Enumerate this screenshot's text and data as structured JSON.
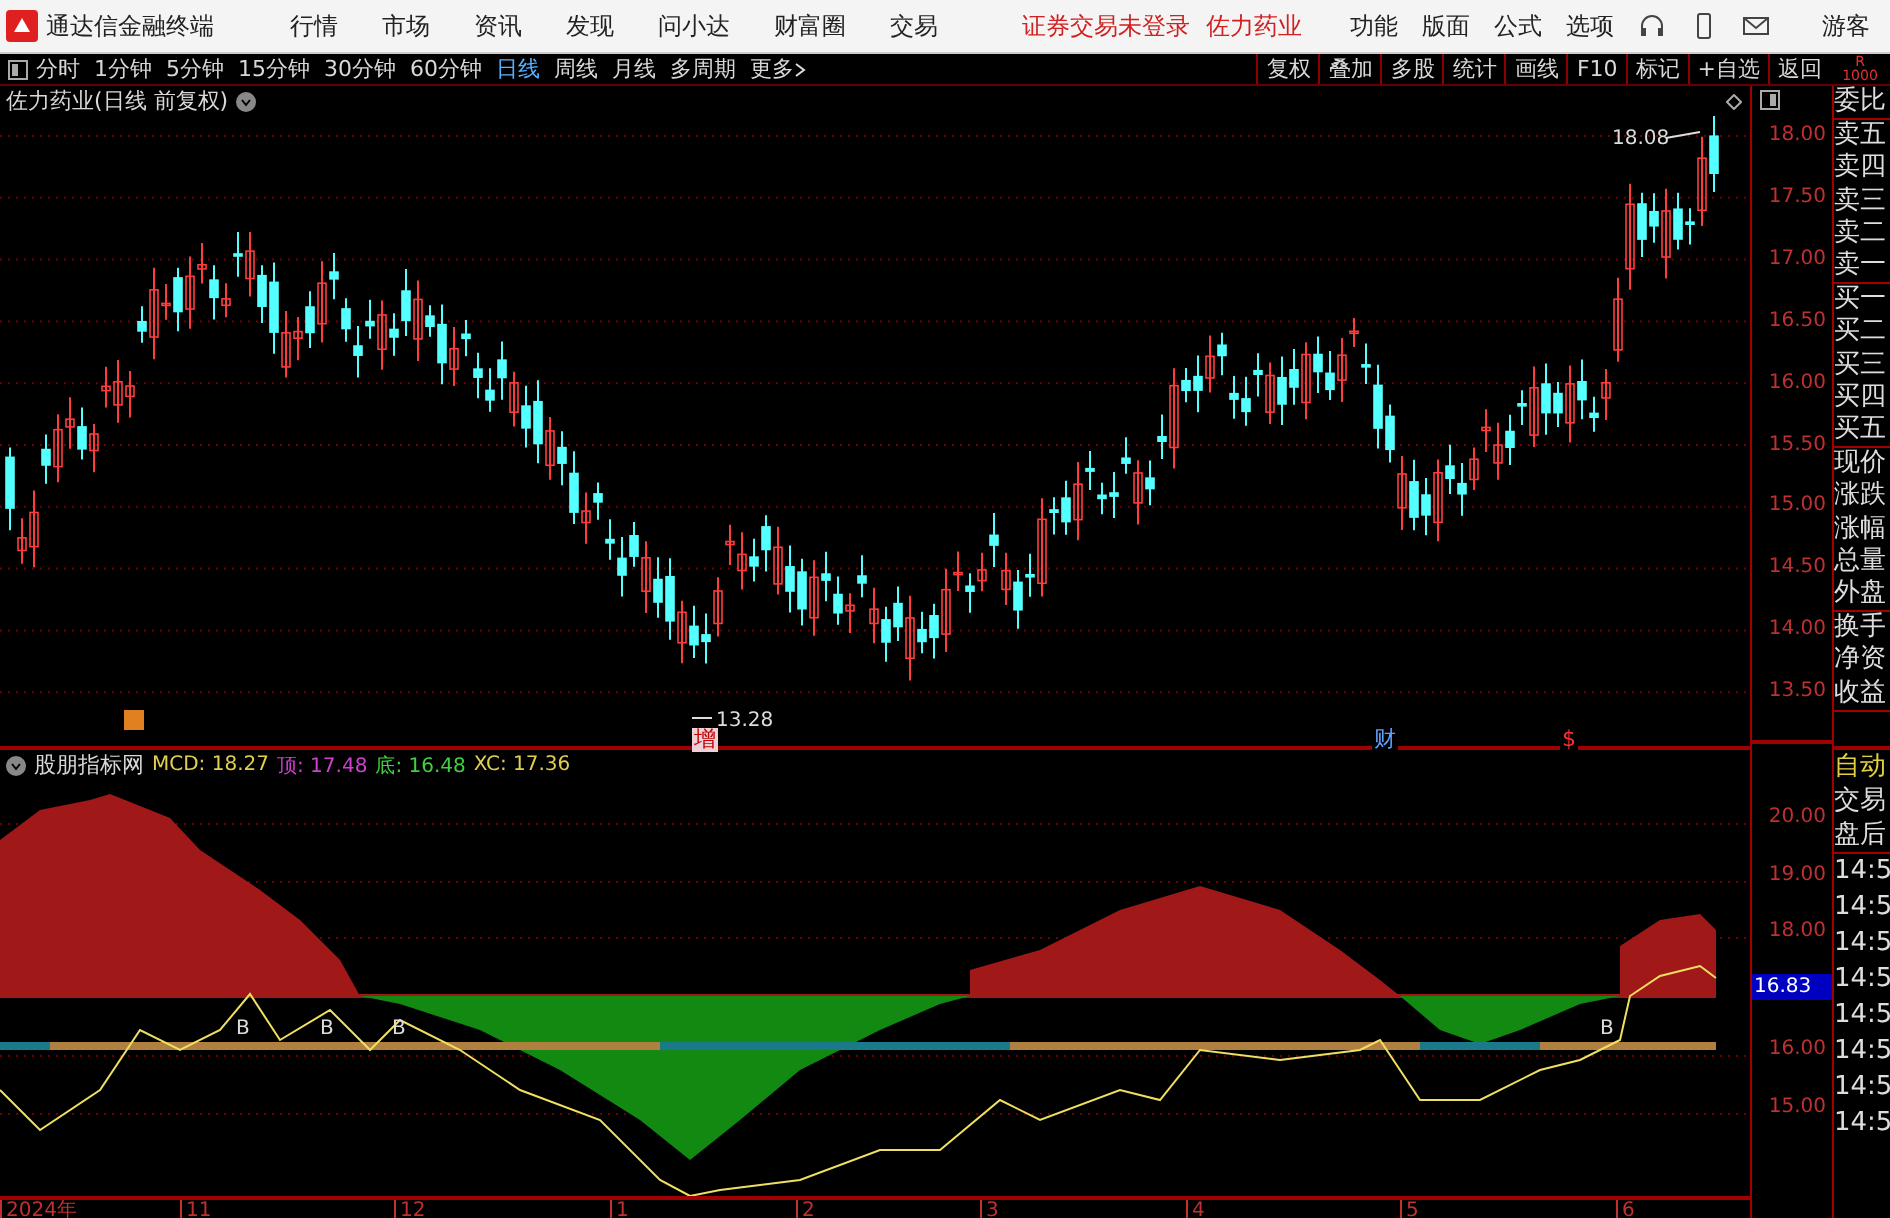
{
  "app": {
    "title": "通达信金融终端",
    "menu": [
      "行情",
      "市场",
      "资讯",
      "发现",
      "问小达",
      "财富圈",
      "交易"
    ],
    "notice": "证券交易未登录",
    "stock": "佐力药业",
    "tools": [
      "功能",
      "版面",
      "公式",
      "选项"
    ],
    "user": "游客"
  },
  "periods": [
    {
      "label": "分时",
      "selected": false
    },
    {
      "label": "1分钟",
      "selected": false
    },
    {
      "label": "5分钟",
      "selected": false
    },
    {
      "label": "15分钟",
      "selected": false
    },
    {
      "label": "30分钟",
      "selected": false
    },
    {
      "label": "60分钟",
      "selected": false
    },
    {
      "label": "日线",
      "selected": true
    },
    {
      "label": "周线",
      "selected": false
    },
    {
      "label": "月线",
      "selected": false
    },
    {
      "label": "多周期",
      "selected": false
    }
  ],
  "more": "更多",
  "actions": [
    "复权",
    "叠加",
    "多股",
    "统计",
    "画线",
    "F10",
    "标记",
    "+自选",
    "返回"
  ],
  "corner": {
    "letter": "R",
    "number": "1000"
  },
  "chart": {
    "title": "佐力药业(日线 前复权)",
    "price_ticks": [
      "18.00",
      "17.50",
      "17.00",
      "16.50",
      "16.00",
      "15.50",
      "15.00",
      "14.50",
      "14.00",
      "13.50"
    ],
    "low_label": "13.28",
    "high_label": "18.08",
    "events": [
      {
        "text": "增",
        "kind": "issue"
      },
      {
        "text": "财",
        "kind": "report"
      },
      {
        "text": "$",
        "kind": "dividend"
      }
    ]
  },
  "indicator": {
    "name": "股朋指标网",
    "values": [
      {
        "label": "MCD: 18.27",
        "color": "#e0d050"
      },
      {
        "label": "顶: 17.48",
        "color": "#d040d0"
      },
      {
        "label": "底: 16.48",
        "color": "#40d040"
      },
      {
        "label": "XC: 17.36",
        "color": "#e0d050"
      }
    ],
    "ticks": [
      "20.00",
      "19.00",
      "18.00",
      "16.00",
      "15.00"
    ],
    "current": "16.83",
    "signals": [
      "B",
      "B",
      "B",
      "B"
    ]
  },
  "dates": [
    "2024年",
    "11",
    "12",
    "1",
    "2",
    "3",
    "4",
    "5",
    "6"
  ],
  "quote_groups": [
    [
      "委比"
    ],
    [
      "卖五",
      "卖四",
      "卖三",
      "卖二",
      "卖一"
    ],
    [
      "买一",
      "买二",
      "买三",
      "买四",
      "买五"
    ],
    [
      "现价",
      "涨跌",
      "涨幅",
      "总量",
      "外盘"
    ],
    [
      "换手",
      "净资",
      "收益"
    ]
  ],
  "modes": [
    {
      "label": "自动",
      "selected": true
    },
    {
      "label": "交易",
      "selected": false
    },
    {
      "label": "盘后",
      "selected": false
    }
  ],
  "times": [
    "14:5",
    "14:5",
    "14:5",
    "14:5",
    "14:5",
    "14:5",
    "14:5",
    "14:5"
  ]
}
